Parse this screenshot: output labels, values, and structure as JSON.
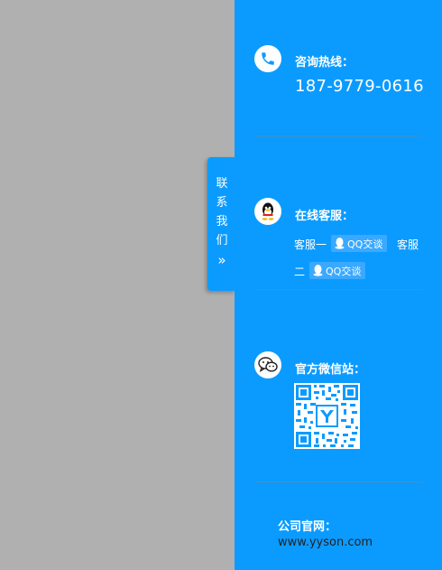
{
  "side_tab": {
    "chars": [
      "联",
      "系",
      "我",
      "们"
    ],
    "arrows": "»"
  },
  "hotline": {
    "label": "咨询热线：",
    "phone": "187-9779-0616"
  },
  "online": {
    "label": "在线客服：",
    "service1": "客服一",
    "service2_part1": "客服",
    "service2_part2": "二",
    "qq_btn": "QQ交谈"
  },
  "wechat": {
    "label": "官方微信站："
  },
  "website": {
    "label": "公司官网：",
    "url": "www.yyson.com"
  },
  "colors": {
    "panel": "#0b9bff",
    "background": "#b0b0b0"
  }
}
